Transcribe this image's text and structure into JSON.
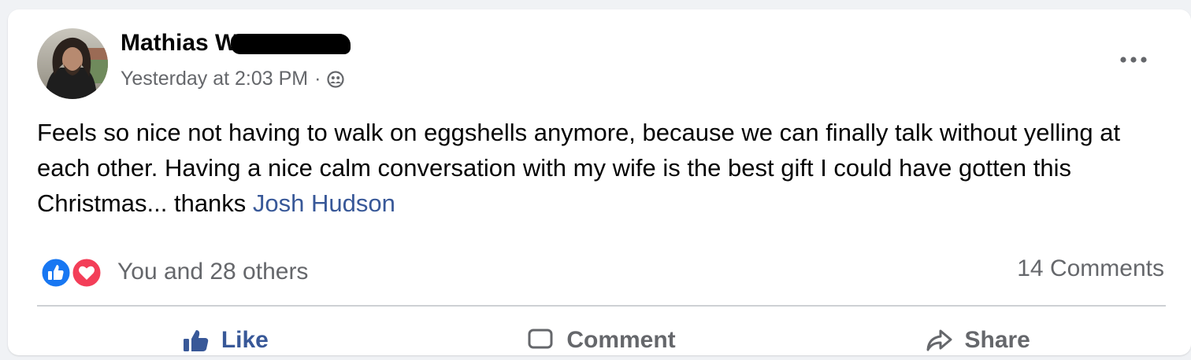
{
  "post": {
    "author": "Mathias W",
    "timestamp": "Yesterday at 2:03 PM",
    "separator": "·",
    "audience_icon": "friends-icon",
    "more_icon": "more-options-icon",
    "text_before_mention": "Feels so nice not having to walk on eggshells anymore, because we can finally talk without yelling at each other. Having a nice calm conversation with my wife is the best gift I could have gotten this Christmas... thanks ",
    "mention": "Josh Hudson"
  },
  "engagement": {
    "reaction_icons": [
      "like-reaction-icon",
      "love-reaction-icon"
    ],
    "reactions_text": "You and 28 others",
    "comments_text": "14 Comments"
  },
  "actions": {
    "like": "Like",
    "comment": "Comment",
    "share": "Share"
  },
  "colors": {
    "page_bg": "#f0f2f5",
    "card_bg": "#ffffff",
    "text_primary": "#050505",
    "text_secondary": "#65676b",
    "link": "#385898",
    "like_blue": "#1877f2",
    "love_red": "#f33e58"
  }
}
